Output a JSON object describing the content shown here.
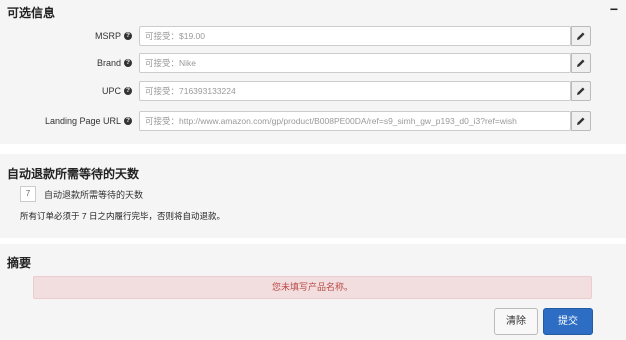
{
  "optional": {
    "title": "可选信息",
    "collapse_symbol": "−",
    "fields": [
      {
        "label": "MSRP",
        "placeholder": "可接受：$19.00"
      },
      {
        "label": "Brand",
        "placeholder": "可接受：Nike"
      },
      {
        "label": "UPC",
        "placeholder": "可接受：716393133224"
      },
      {
        "label": "Landing Page URL",
        "placeholder": "可接受：http://www.amazon.com/gp/product/B008PE00DA/ref=s9_simh_gw_p193_d0_i3?ref=wish"
      }
    ]
  },
  "refund": {
    "title": "自动退款所需等待的天数",
    "days_value": "7",
    "days_label": "自动退款所需等待的天数",
    "note": "所有订单必须于 7 日之内履行完毕，否则将自动退款。"
  },
  "summary": {
    "title": "摘要",
    "error_message": "您未填写产品名称。",
    "clear_label": "清除",
    "submit_label": "提交"
  },
  "colors": {
    "error_bg": "#f2dede",
    "error_text": "#b94a48",
    "primary": "#2d6ec4"
  }
}
